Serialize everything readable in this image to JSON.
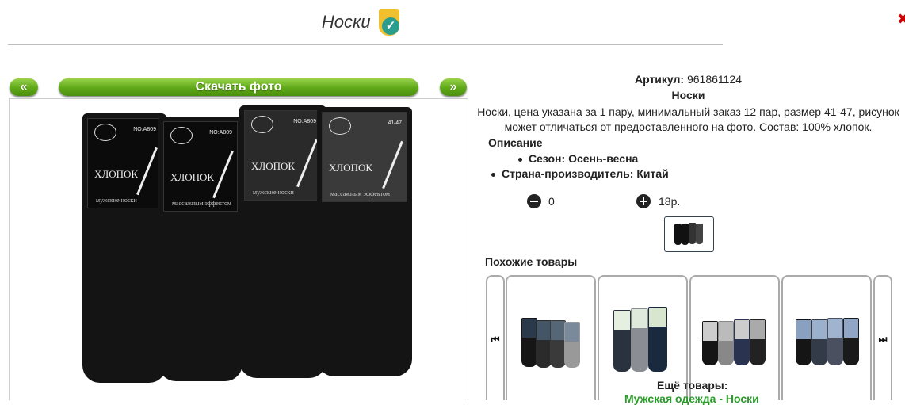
{
  "header": {
    "title": "Носки",
    "verified_icon": "verified-shield-check-icon"
  },
  "gallery": {
    "prev_label": "«",
    "download_label": "Скачать фото",
    "next_label": "»",
    "photo_text": {
      "brand": "ХЛОПОК",
      "subtitle_1": "мужские носки",
      "subtitle_2": "массажным эффектом",
      "code": "NO:A809",
      "size": "41/47"
    }
  },
  "product": {
    "sku_label": "Артикул:",
    "sku_value": "961861124",
    "name": "Носки",
    "description": "Носки, цена указана за 1 пару, минимальный заказ 12 пар, размер 41-47, рисунок может отличаться от предоставленного на фото. Состав: 100% хлопок.",
    "description_heading": "Описание",
    "attributes": [
      {
        "label": "Сезон:",
        "value": "Осень-весна"
      },
      {
        "label": "Страна-производитель:",
        "value": "Китай"
      }
    ],
    "quantity": "0",
    "price": "18р."
  },
  "similar": {
    "heading": "Похожие товары",
    "prev_icon": "step-backward-icon",
    "next_icon": "step-forward-icon",
    "prev_glyph": "⏮",
    "next_glyph": "⏭"
  },
  "more": {
    "heading": "Ещё товары:",
    "link": "Мужская одежда - Носки"
  },
  "colors": {
    "accent_green": "#5fa818",
    "link_green": "#2a9d2a",
    "shield_yellow": "#f0c030",
    "check_teal": "#2a9d8f"
  }
}
